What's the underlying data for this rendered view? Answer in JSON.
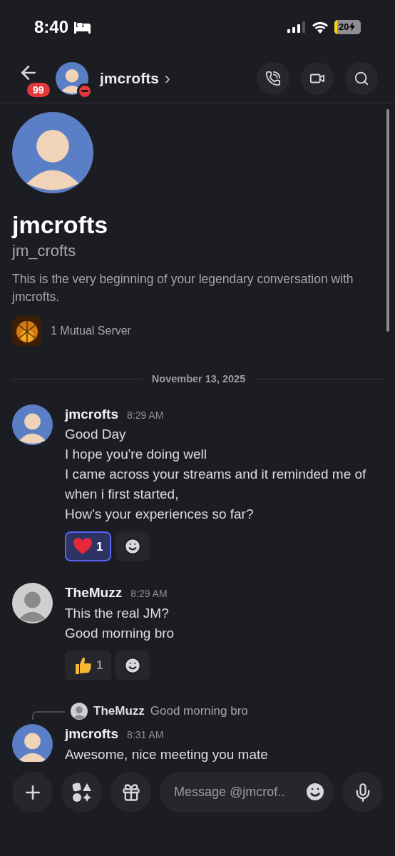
{
  "status_bar": {
    "time": "8:40",
    "battery": "20"
  },
  "header": {
    "back_badge": "99",
    "title": "jmcrofts",
    "chevron": "›",
    "do_not_disturb": true
  },
  "profile": {
    "display_name": "jmcrofts",
    "username": "jm_crofts",
    "intro": "This is the very beginning of your legendary conversation with jmcrofts.",
    "mutual_servers": "1 Mutual Server"
  },
  "date_divider": "November 13, 2025",
  "messages": [
    {
      "author": "jmcrofts",
      "avatar": {
        "color": "#5b7fc7"
      },
      "time": "8:29 AM",
      "lines": [
        "Good Day",
        "I hope you're doing well",
        "I came across your streams and it reminded me of when i first started,",
        "How's your experiences so far?"
      ],
      "reactions": [
        {
          "kind": "heart",
          "count": "1",
          "selected": true
        }
      ]
    },
    {
      "author": "TheMuzz",
      "avatar": {
        "color": "#cfcfcf"
      },
      "time": "8:29 AM",
      "lines": [
        "This the real JM?",
        "Good morning bro"
      ],
      "reactions": [
        {
          "kind": "thumbs-up",
          "count": "1",
          "selected": false
        }
      ]
    },
    {
      "author": "jmcrofts",
      "avatar": {
        "color": "#5b7fc7"
      },
      "time": "8:31 AM",
      "reply": {
        "author": "TheMuzz",
        "text": "Good morning bro"
      },
      "lines": [
        "Awesome, nice meeting you mate"
      ]
    }
  ],
  "composer": {
    "placeholder": "Message @jmcrof.."
  }
}
